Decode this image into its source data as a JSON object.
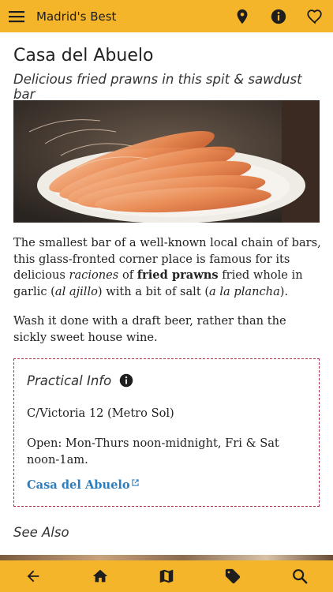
{
  "app": {
    "title": "Madrid's Best"
  },
  "topbar": {
    "icons": [
      "menu-icon",
      "map-pin-icon",
      "info-icon",
      "heart-icon"
    ]
  },
  "place": {
    "name": "Casa del Abuelo",
    "tagline": "Delicious fried prawns in this spit & sawdust bar"
  },
  "description": {
    "p1": [
      {
        "text": "The smallest bar of a well-known local chain of bars, this glass-fronted corner place is famous for its delicious ",
        "style": "normal"
      },
      {
        "text": "raciones",
        "style": "italic"
      },
      {
        "text": " of ",
        "style": "normal"
      },
      {
        "text": "fried prawns",
        "style": "bold"
      },
      {
        "text": " fried whole in garlic (",
        "style": "normal"
      },
      {
        "text": "al ajillo",
        "style": "italic"
      },
      {
        "text": ") with a bit of salt (",
        "style": "normal"
      },
      {
        "text": "a la plancha",
        "style": "italic"
      },
      {
        "text": ").",
        "style": "normal"
      }
    ],
    "p2": "Wash it done with a draft beer, rather than the sickly sweet house wine."
  },
  "practical_info": {
    "heading": "Practical Info",
    "address": "C/Victoria 12 (Metro Sol)",
    "hours": "Open: Mon-Thurs noon-midnight, Fri & Sat noon-1am.",
    "link_label": "Casa del Abuelo"
  },
  "see_also": {
    "heading": "See Also"
  },
  "bottom_nav": {
    "icons": [
      "back-arrow-icon",
      "home-icon",
      "map-icon",
      "tag-icon",
      "search-icon"
    ]
  },
  "colors": {
    "accent": "#f5b52a",
    "link": "#2c7dbd",
    "box_border": "#b0334d"
  }
}
